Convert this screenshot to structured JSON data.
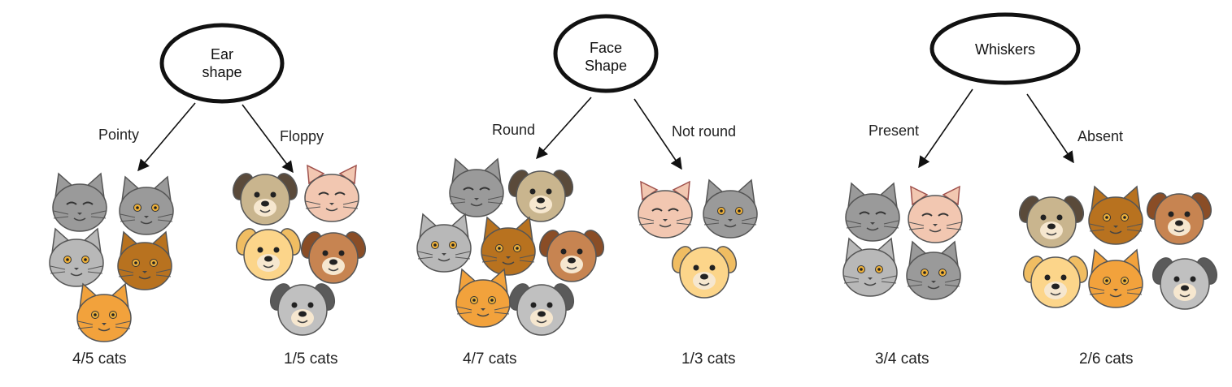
{
  "colors": {
    "grey_cat": "#9a9a9a",
    "orange_cat": "#f2a23c",
    "brown_cat": "#b8721f",
    "pink_cat": "#f2c7b1",
    "pug_dog": "#c9b58e",
    "yellow_dog": "#fcd58a",
    "brown_dog": "#c78451",
    "grey_dog": "#c0c0c0"
  },
  "splits": [
    {
      "feature": [
        "Ear",
        "shape"
      ],
      "left_label": "Pointy",
      "right_label": "Floppy",
      "left_count": "4/5 cats",
      "right_count": "1/5 cats",
      "left_animals": [
        "grey-cat-closed-eyes",
        "grey-cat-pointy",
        "grey-cat-round",
        "brown-cat",
        "orange-cat"
      ],
      "right_animals": [
        "pug-dog",
        "pink-cat",
        "yellow-dog",
        "brown-dog",
        "grey-dog"
      ]
    },
    {
      "feature": [
        "Face",
        "Shape"
      ],
      "left_label": "Round",
      "right_label": "Not round",
      "left_count": "4/7 cats",
      "right_count": "1/3 cats",
      "left_animals": [
        "grey-cat-closed-eyes",
        "pug-dog",
        "grey-cat-round",
        "brown-cat",
        "brown-dog",
        "orange-cat",
        "grey-dog"
      ],
      "right_animals": [
        "pink-cat",
        "grey-cat-pointy",
        "yellow-dog"
      ]
    },
    {
      "feature": [
        "Whiskers"
      ],
      "left_label": "Present",
      "right_label": "Absent",
      "left_count": "3/4 cats",
      "right_count": "2/6 cats",
      "left_animals": [
        "grey-cat-closed-eyes",
        "pink-cat",
        "grey-cat-round",
        "grey-cat-pointy"
      ],
      "right_animals": [
        "pug-dog",
        "brown-cat",
        "brown-dog",
        "yellow-dog",
        "orange-cat",
        "grey-dog"
      ]
    }
  ]
}
